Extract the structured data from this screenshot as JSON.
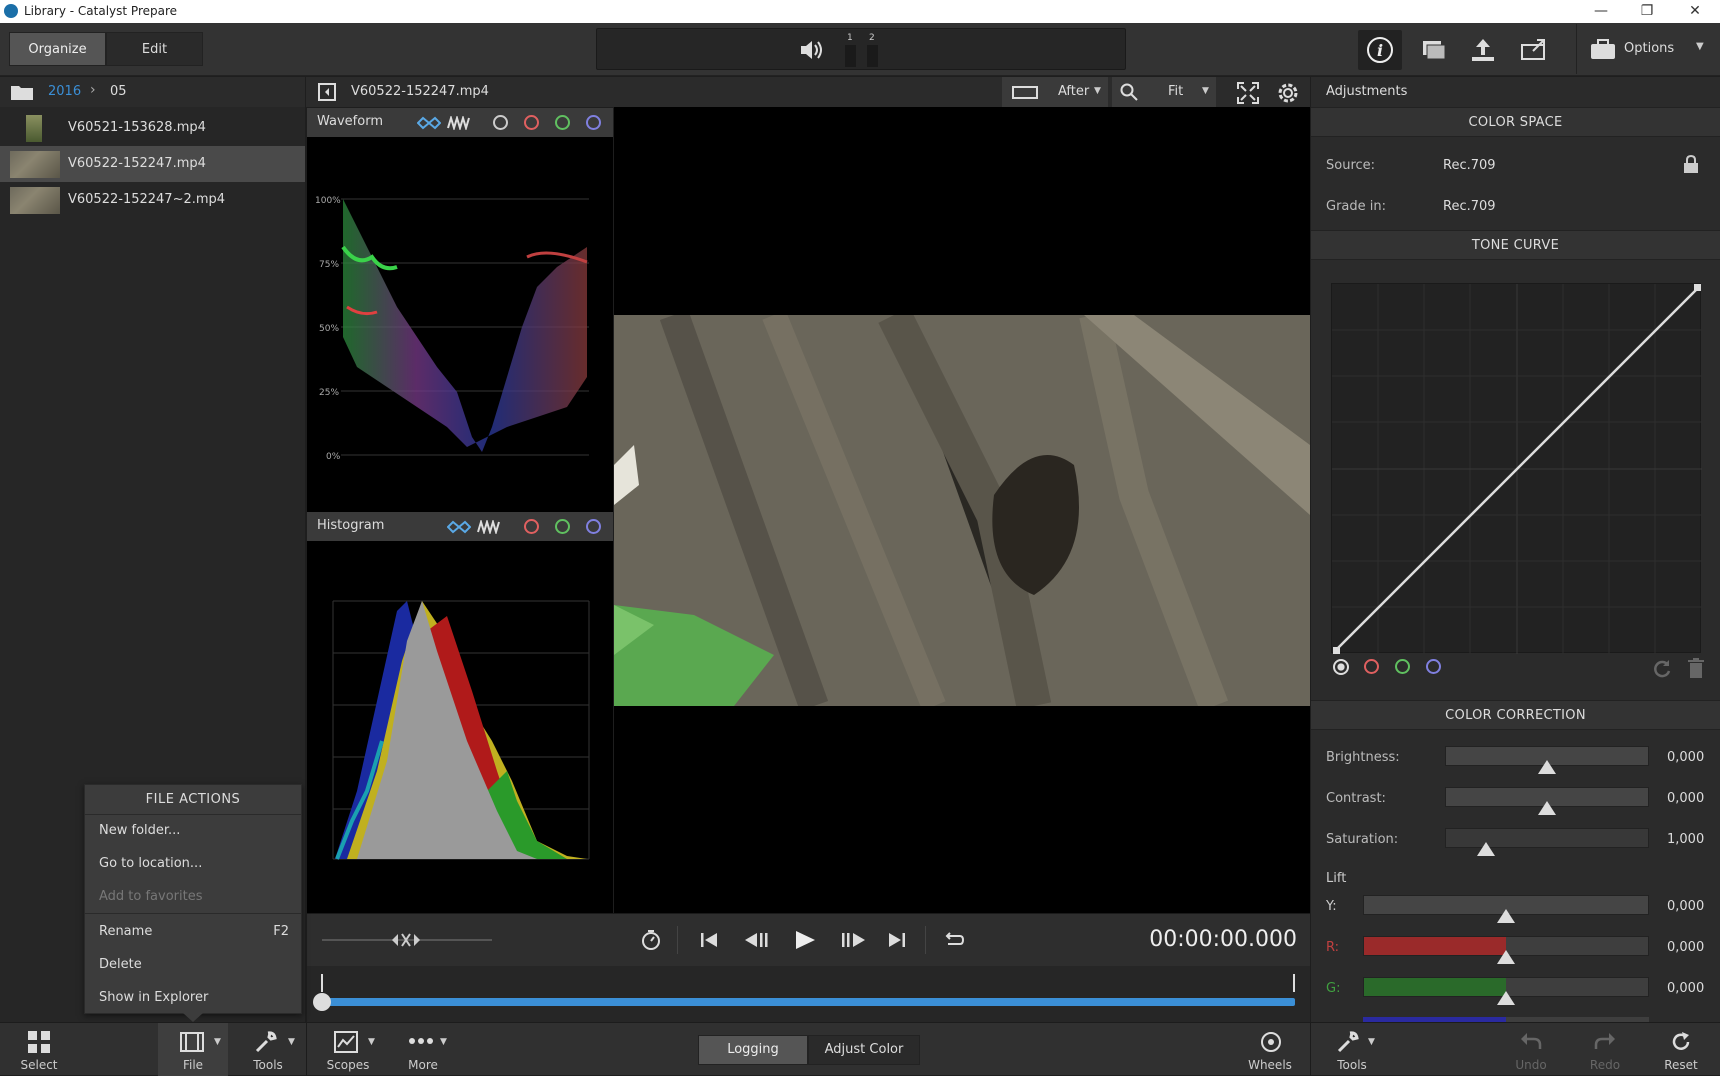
{
  "window": {
    "title": "Library - Catalyst Prepare",
    "controls": [
      "minimize",
      "restore",
      "close"
    ]
  },
  "toolbar": {
    "modes": [
      {
        "label": "Organize",
        "active": true
      },
      {
        "label": "Edit",
        "active": false
      }
    ],
    "audio_channels": [
      "1",
      "2"
    ],
    "options_label": "Options"
  },
  "library": {
    "breadcrumb": [
      "2016",
      "05"
    ],
    "files": [
      {
        "name": "V60521-153628.mp4",
        "selected": false
      },
      {
        "name": "V60522-152247.mp4",
        "selected": true
      },
      {
        "name": "V60522-152247~2.mp4",
        "selected": false
      }
    ]
  },
  "file_actions_menu": {
    "header": "FILE ACTIONS",
    "items": [
      {
        "label": "New folder...",
        "enabled": true,
        "shortcut": ""
      },
      {
        "label": "Go to location...",
        "enabled": true,
        "shortcut": ""
      },
      {
        "label": "Add to favorites",
        "enabled": false,
        "shortcut": ""
      },
      {
        "label": "Rename",
        "enabled": true,
        "shortcut": "F2"
      },
      {
        "label": "Delete",
        "enabled": true,
        "shortcut": ""
      },
      {
        "label": "Show in Explorer",
        "enabled": true,
        "shortcut": ""
      }
    ]
  },
  "viewer": {
    "clip_name": "V60522-152247.mp4",
    "view_mode": "After",
    "zoom": "Fit",
    "timecode": "00:00:00.000"
  },
  "scopes": {
    "waveform": {
      "title": "Waveform",
      "scale_labels": [
        "100%",
        "75%",
        "50%",
        "25%",
        "0%"
      ]
    },
    "histogram": {
      "title": "Histogram"
    }
  },
  "bottom_bar": {
    "left_items": [
      "Select",
      "File",
      "Tools"
    ],
    "center_items": [
      "Scopes",
      "More"
    ],
    "workspace_tabs": [
      {
        "label": "Logging",
        "active": true
      },
      {
        "label": "Adjust Color",
        "active": false
      }
    ],
    "wheels_label": "Wheels",
    "right_items": [
      {
        "label": "Tools",
        "enabled": true
      },
      {
        "label": "Undo",
        "enabled": false
      },
      {
        "label": "Redo",
        "enabled": false
      },
      {
        "label": "Reset",
        "enabled": true
      }
    ]
  },
  "adjustments": {
    "title": "Adjustments",
    "color_space": {
      "header": "COLOR SPACE",
      "source_label": "Source:",
      "source_value": "Rec.709",
      "grade_label": "Grade in:",
      "grade_value": "Rec.709"
    },
    "tone_curve": {
      "header": "TONE CURVE"
    },
    "color_correction": {
      "header": "COLOR CORRECTION",
      "brightness": {
        "label": "Brightness:",
        "value": "0,000",
        "level": 0.5
      },
      "contrast": {
        "label": "Contrast:",
        "value": "0,000",
        "level": 0.5
      },
      "saturation": {
        "label": "Saturation:",
        "value": "1,000",
        "level": 0.2
      },
      "lift_label": "Lift",
      "lift": [
        {
          "label": "Y:",
          "value": "0,000",
          "color": "#4a4a4a",
          "level": 0.5
        },
        {
          "label": "R:",
          "value": "0,000",
          "color": "#9a2a2a",
          "level": 0.5
        },
        {
          "label": "G:",
          "value": "0,000",
          "color": "#2a6a2a",
          "level": 0.5
        }
      ]
    }
  },
  "colors": {
    "accent": "#3b8fd6",
    "panel_bg": "#2b2b2b"
  }
}
